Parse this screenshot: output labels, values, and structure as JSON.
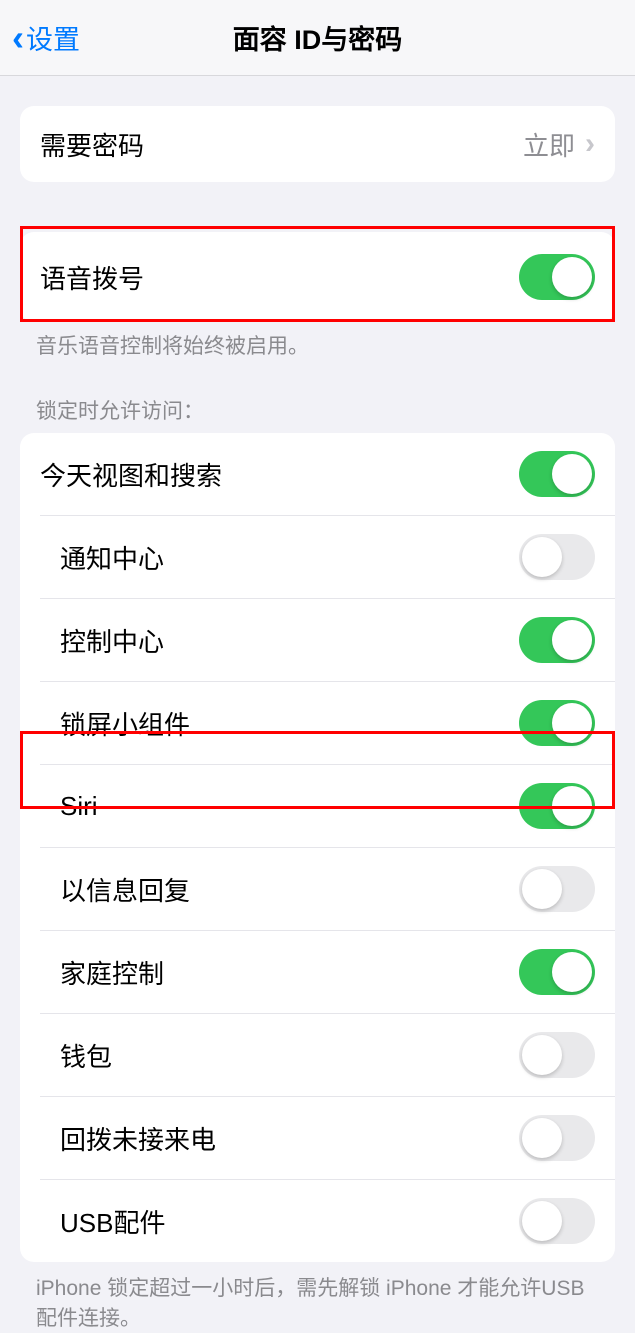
{
  "header": {
    "back_label": "设置",
    "title": "面容 ID与密码"
  },
  "passcode_group": {
    "require_label": "需要密码",
    "require_value": "立即"
  },
  "voice_dial_group": {
    "label": "语音拨号",
    "enabled": true,
    "footer": "音乐语音控制将始终被启用。"
  },
  "lock_access_header": "锁定时允许访问：",
  "lock_access_items": [
    {
      "label": "今天视图和搜索",
      "enabled": true
    },
    {
      "label": "通知中心",
      "enabled": false
    },
    {
      "label": "控制中心",
      "enabled": true
    },
    {
      "label": "锁屏小组件",
      "enabled": true
    },
    {
      "label": "Siri",
      "enabled": true
    },
    {
      "label": "以信息回复",
      "enabled": false
    },
    {
      "label": "家庭控制",
      "enabled": true
    },
    {
      "label": "钱包",
      "enabled": false
    },
    {
      "label": "回拨未接来电",
      "enabled": false
    },
    {
      "label": "USB配件",
      "enabled": false
    }
  ],
  "usb_footer": "iPhone 锁定超过一小时后，需先解锁 iPhone 才能允许USB 配件连接。"
}
